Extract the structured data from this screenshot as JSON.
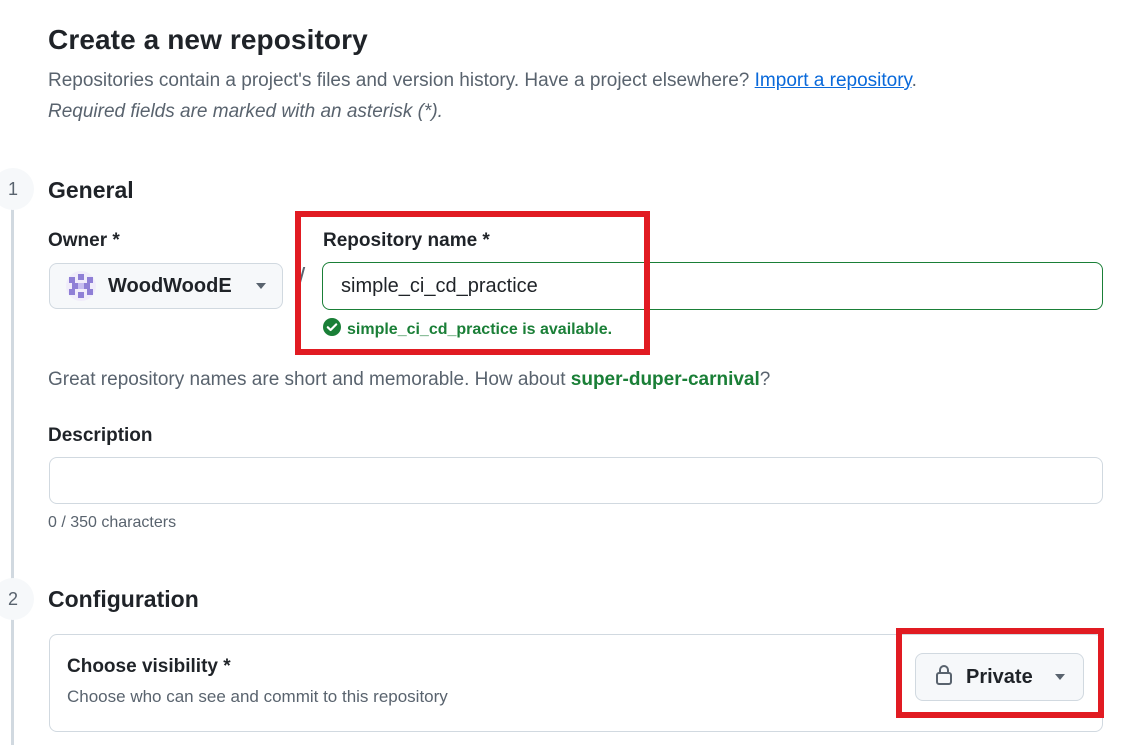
{
  "header": {
    "title": "Create a new repository",
    "subtitle_text": "Repositories contain a project's files and version history. Have a project elsewhere?",
    "import_link": "Import a repository",
    "subtitle_end": ".",
    "required_note": "Required fields are marked with an asterisk (*)."
  },
  "steps": [
    {
      "number": "1",
      "title": "General"
    },
    {
      "number": "2",
      "title": "Configuration"
    }
  ],
  "owner": {
    "label": "Owner *",
    "value": "WoodWoodE"
  },
  "separator": "/",
  "repo_name": {
    "label": "Repository name *",
    "value": "simple_ci_cd_practice",
    "availability": "simple_ci_cd_practice is available."
  },
  "suggestion": {
    "text": "Great repository names are short and memorable. How about",
    "name": "super-duper-carnival",
    "end": "?"
  },
  "description": {
    "label": "Description",
    "value": "",
    "char_count": "0 / 350 characters"
  },
  "visibility": {
    "label": "Choose visibility *",
    "help": "Choose who can see and commit to this repository",
    "value": "Private"
  },
  "colors": {
    "success": "#1a7f37",
    "link": "#0969da",
    "highlight": "#e11b22"
  },
  "icons": {
    "owner_avatar": "avatar",
    "owner_caret": "triangle-down-icon",
    "availability": "check-circle-icon",
    "visibility": "lock-icon",
    "visibility_caret": "triangle-down-icon"
  }
}
